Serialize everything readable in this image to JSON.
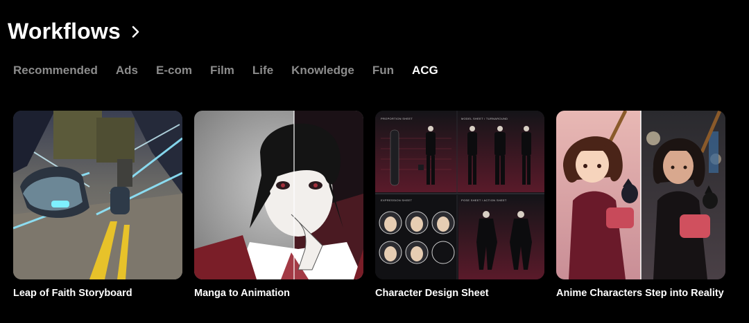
{
  "header": {
    "title": "Workflows",
    "chevron_icon": "chevron-right-icon"
  },
  "tabs": [
    {
      "label": "Recommended",
      "active": false
    },
    {
      "label": "Ads",
      "active": false
    },
    {
      "label": "E-com",
      "active": false
    },
    {
      "label": "Film",
      "active": false
    },
    {
      "label": "Life",
      "active": false
    },
    {
      "label": "Knowledge",
      "active": false
    },
    {
      "label": "Fun",
      "active": false
    },
    {
      "label": "ACG",
      "active": true
    }
  ],
  "cards": [
    {
      "title": "Leap of Faith Storyboard"
    },
    {
      "title": "Manga to Animation"
    },
    {
      "title": "Character Design Sheet",
      "sheet_labels": {
        "proportion": "PROPORTION SHEET",
        "model": "MODEL SHEET / TURNAROUND",
        "expression": "EXPRESSION SHEET",
        "pose": "POSE SHEET / ACTION SHEET"
      }
    },
    {
      "title": "Anime Characters Step into Reality"
    }
  ],
  "colors": {
    "background": "#000000",
    "tab_active": "#ffffff",
    "tab_inactive": "#8c8c8c"
  }
}
